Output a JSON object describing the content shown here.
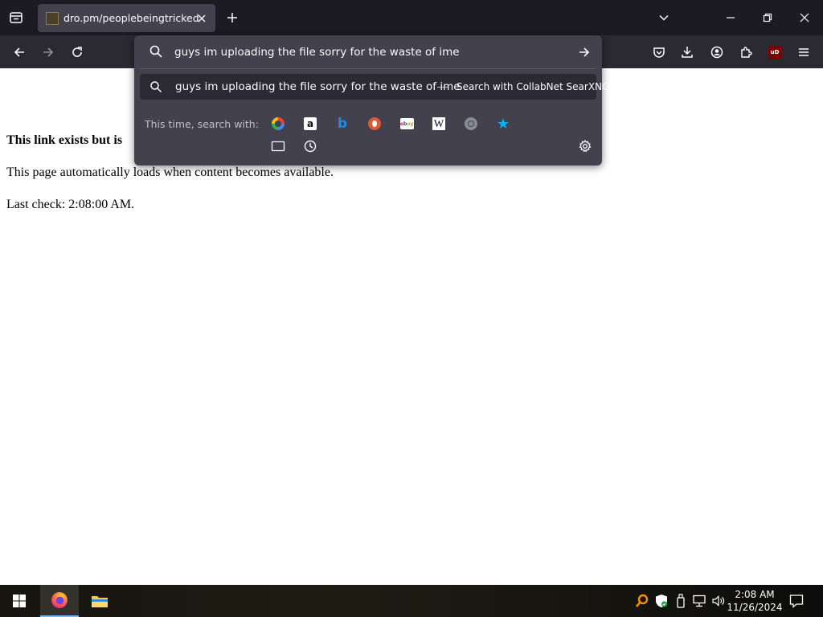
{
  "tabstrip": {
    "active_tab": {
      "title": "dro.pm/peoplebeingtricked"
    }
  },
  "urlbar": {
    "value": "guys im uploading the file sorry for the waste of ime"
  },
  "suggestion": {
    "text": "guys im uploading the file sorry for the waste of ime",
    "separator": "—",
    "action": "Search with CollabNet SearXNG"
  },
  "one_time_search": {
    "label": "This time, search with:",
    "engines": [
      "google",
      "amazon",
      "bing",
      "duckduckgo",
      "ebay",
      "wikipedia",
      "searxng",
      "bookmarks",
      "tabs",
      "history"
    ]
  },
  "page": {
    "heading": "This link exists but is",
    "para1": "This page automatically loads when content becomes available.",
    "para2": "Last check: 2:08:00 AM."
  },
  "taskbar": {
    "time": "2:08 AM",
    "date": "11/26/2024"
  },
  "colors": {
    "tabstrip_bg": "#1c1b22",
    "navbar_bg": "#2b2a33",
    "popup_bg": "#42414d",
    "text_light": "#fbfbfe",
    "accent_blue": "#00b3f4"
  }
}
